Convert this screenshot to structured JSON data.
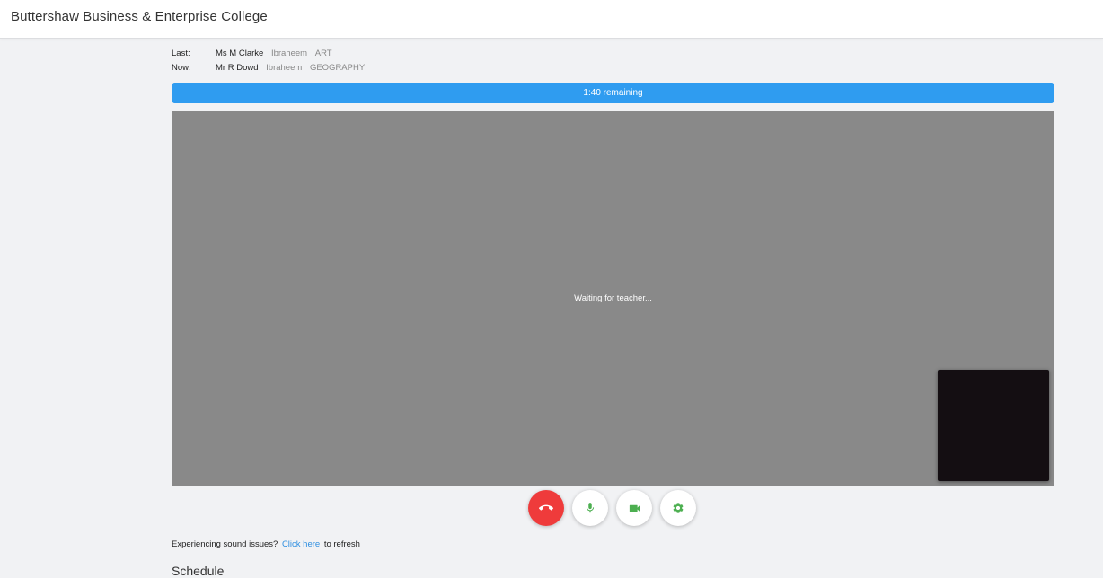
{
  "app": {
    "title": "Buttershaw Business & Enterprise College"
  },
  "lessons": {
    "last": {
      "key": "Last:",
      "teacher": "Ms M Clarke",
      "student": "Ibraheem",
      "subject": "ART"
    },
    "now": {
      "key": "Now:",
      "teacher": "Mr R Dowd",
      "student": "Ibraheem",
      "subject": "GEOGRAPHY"
    }
  },
  "timer": {
    "text": "1:40 remaining",
    "progress_fraction": 1.0,
    "color": "#2f9cf0"
  },
  "video": {
    "status": "Waiting for teacher..."
  },
  "controls": {
    "hangup": {
      "icon": "phone-hangup-icon",
      "color": "#ef3b3b"
    },
    "mic": {
      "icon": "microphone-icon",
      "color": "#4caf50"
    },
    "camera": {
      "icon": "video-camera-icon",
      "color": "#4caf50"
    },
    "settings": {
      "icon": "gear-icon",
      "color": "#4caf50"
    }
  },
  "sound_help": {
    "prefix": "Experiencing sound issues?",
    "link": "Click here",
    "suffix": "to refresh"
  },
  "schedule": {
    "heading": "Schedule"
  }
}
